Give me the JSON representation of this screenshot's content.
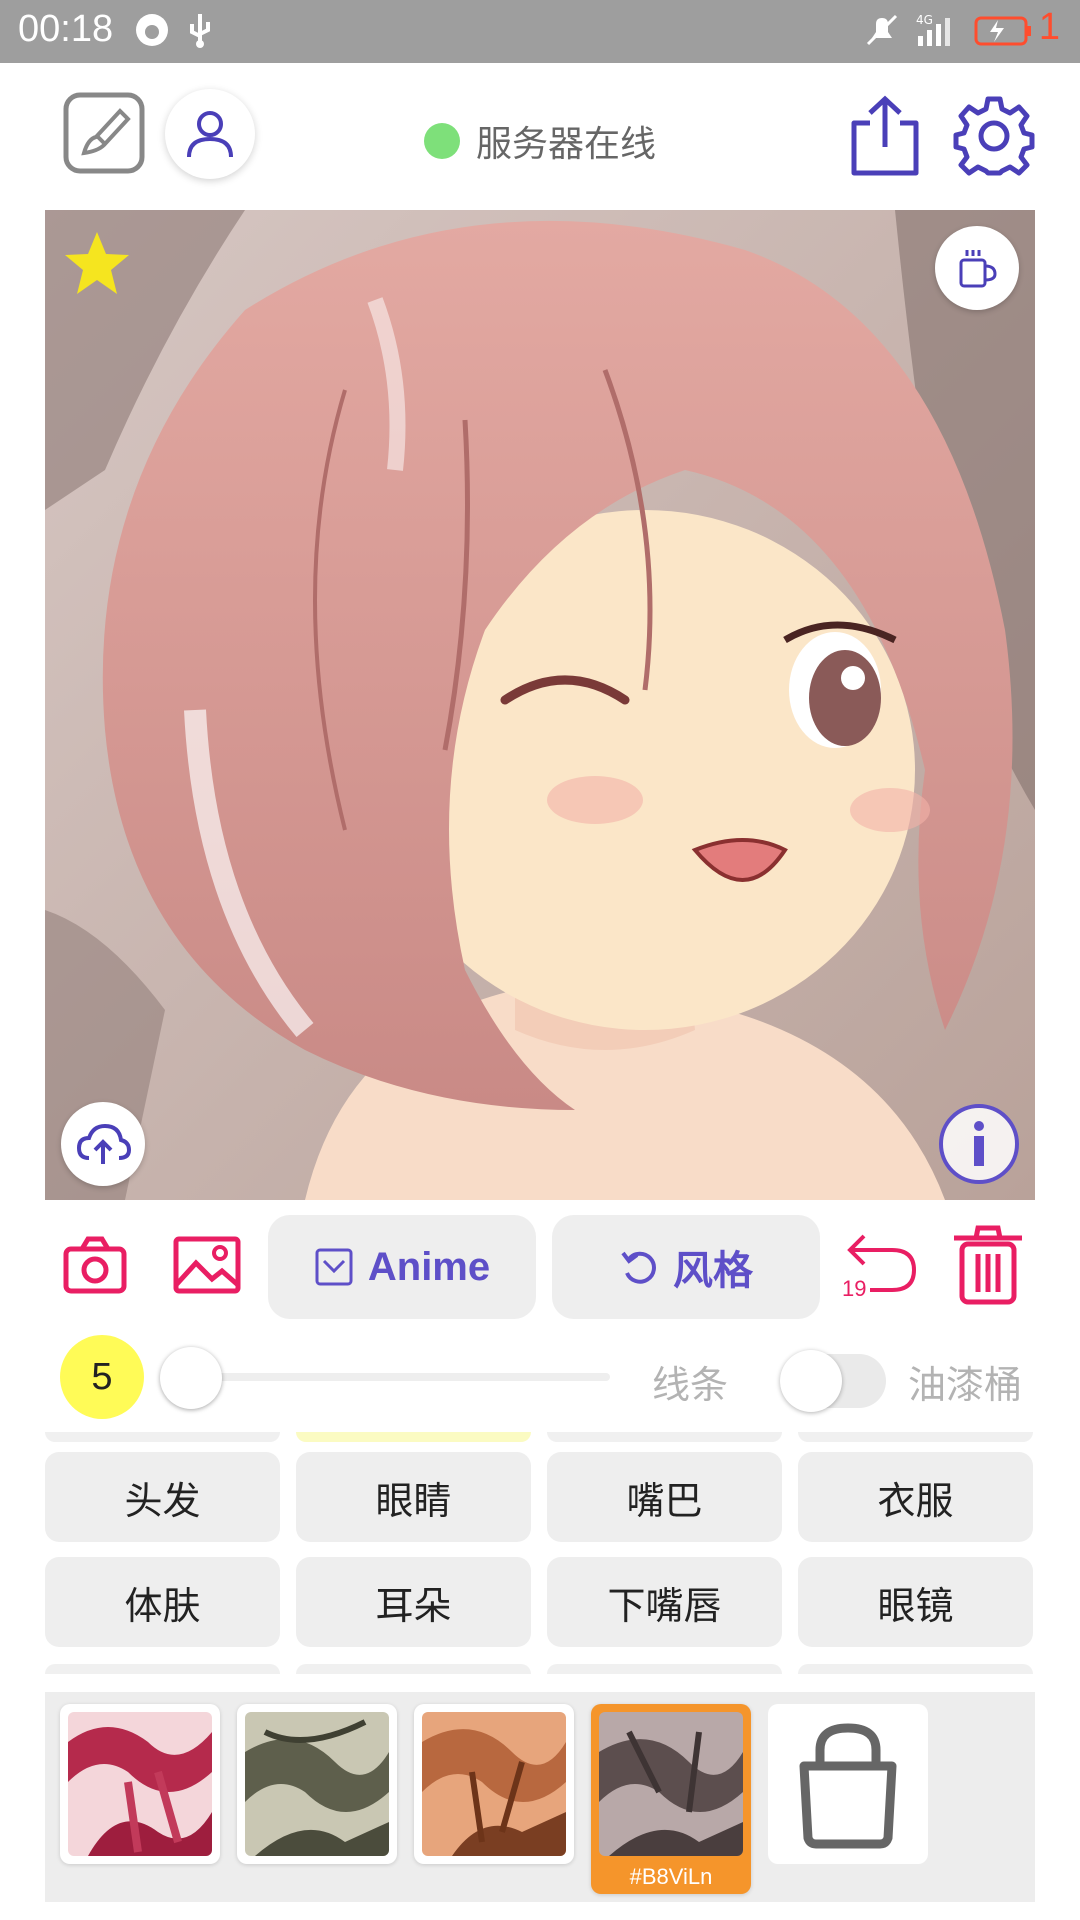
{
  "status_bar": {
    "time": "00:18",
    "battery_level": "1"
  },
  "header": {
    "server_status": "服务器在线"
  },
  "toolbar": {
    "mode_label": "Anime",
    "style_label": "风格",
    "undo_count": "19"
  },
  "brush": {
    "size": "5",
    "line_label": "线条",
    "bucket_label": "油漆桶"
  },
  "parts": {
    "row1": [
      "头发",
      "眼睛",
      "嘴巴",
      "衣服"
    ],
    "row2": [
      "体肤",
      "耳朵",
      "下嘴唇",
      "眼镜"
    ]
  },
  "palette": {
    "selected_code": "#B8ViLn"
  },
  "colors": {
    "accent": "#5e4fc8",
    "danger": "#e91e63",
    "online": "#7ee07a",
    "brush_badge": "#fffb57",
    "selected_swatch": "#f5952b"
  }
}
